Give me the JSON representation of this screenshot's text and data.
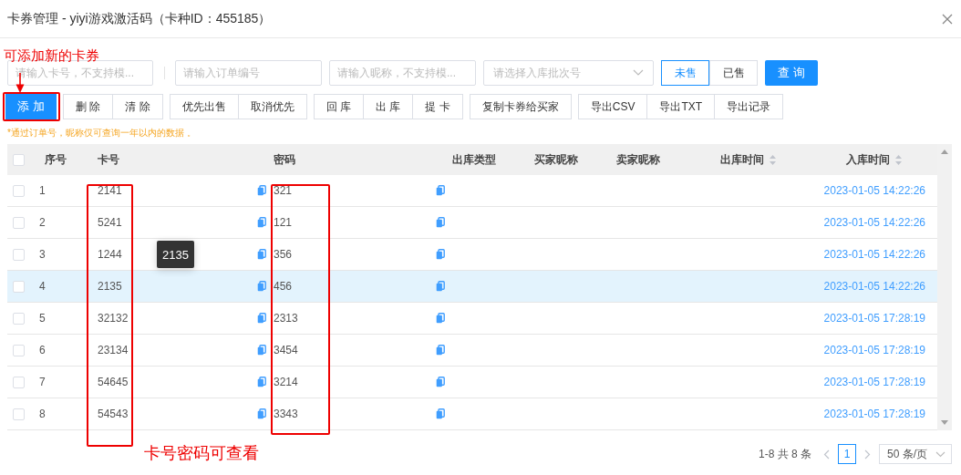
{
  "dialog": {
    "title": "卡券管理 - yiyi游戏激活码（卡种ID：455185）"
  },
  "annotations": {
    "add_hint": "可添加新的卡券",
    "view_hint": "卡号密码可查看"
  },
  "filters": [
    {
      "placeholder": "请输入卡号，不支持模..."
    },
    {
      "placeholder": "请输入订单编号"
    },
    {
      "placeholder": "请输入昵称，不支持模..."
    }
  ],
  "batch_select": {
    "placeholder": "请选择入库批次号"
  },
  "status_toggle": [
    {
      "label": "未售",
      "selected": true
    },
    {
      "label": "已售",
      "selected": false
    }
  ],
  "query_button": "查 询",
  "button_groups": [
    {
      "buttons": [
        {
          "label": "添 加",
          "kind": "primary"
        }
      ]
    },
    {
      "buttons": [
        {
          "label": "删 除",
          "kind": "default"
        },
        {
          "label": "清 除",
          "kind": "default"
        }
      ]
    },
    {
      "buttons": [
        {
          "label": "优先出售",
          "kind": "default"
        },
        {
          "label": "取消优先",
          "kind": "default"
        }
      ]
    },
    {
      "buttons": [
        {
          "label": "回 库",
          "kind": "default"
        },
        {
          "label": "出 库",
          "kind": "default"
        },
        {
          "label": "提 卡",
          "kind": "default"
        }
      ]
    },
    {
      "buttons": [
        {
          "label": "复制卡券给买家",
          "kind": "default"
        }
      ]
    },
    {
      "buttons": [
        {
          "label": "导出CSV",
          "kind": "default"
        },
        {
          "label": "导出TXT",
          "kind": "default"
        },
        {
          "label": "导出记录",
          "kind": "default"
        }
      ]
    }
  ],
  "note": "*通过订单号，昵称仅可查询一年以内的数据 。",
  "table": {
    "header_checked": false,
    "columns": [
      {
        "label": "序号",
        "sortable": false
      },
      {
        "label": "卡号",
        "sortable": false
      },
      {
        "label": "密码",
        "sortable": false
      },
      {
        "label": "出库类型",
        "sortable": false
      },
      {
        "label": "买家昵称",
        "sortable": false
      },
      {
        "label": "卖家昵称",
        "sortable": false
      },
      {
        "label": "出库时间",
        "sortable": true
      },
      {
        "label": "入库时间",
        "sortable": true
      }
    ],
    "rows": [
      {
        "no": "1",
        "card": "2141",
        "password": "321",
        "in_time": "2023-01-05 14:22:26",
        "checked": false,
        "highlighted": false
      },
      {
        "no": "2",
        "card": "5241",
        "password": "121",
        "in_time": "2023-01-05 14:22:26",
        "checked": false,
        "highlighted": false
      },
      {
        "no": "3",
        "card": "1244",
        "password": "356",
        "in_time": "2023-01-05 14:22:26",
        "checked": false,
        "highlighted": false
      },
      {
        "no": "4",
        "card": "2135",
        "password": "456",
        "in_time": "2023-01-05 14:22:26",
        "checked": false,
        "highlighted": true
      },
      {
        "no": "5",
        "card": "32132",
        "password": "2313",
        "in_time": "2023-01-05 17:28:19",
        "checked": false,
        "highlighted": false
      },
      {
        "no": "6",
        "card": "23134",
        "password": "3454",
        "in_time": "2023-01-05 17:28:19",
        "checked": false,
        "highlighted": false
      },
      {
        "no": "7",
        "card": "54645",
        "password": "3214",
        "in_time": "2023-01-05 17:28:19",
        "checked": false,
        "highlighted": false
      },
      {
        "no": "8",
        "card": "54543",
        "password": "3343",
        "in_time": "2023-01-05 17:28:19",
        "checked": false,
        "highlighted": false
      }
    ]
  },
  "tooltip": {
    "text": "2135"
  },
  "pagination": {
    "summary": "1-8 共 8 条",
    "pages": [
      {
        "label": "1",
        "selected": true
      }
    ],
    "page_size": "50 条/页"
  }
}
